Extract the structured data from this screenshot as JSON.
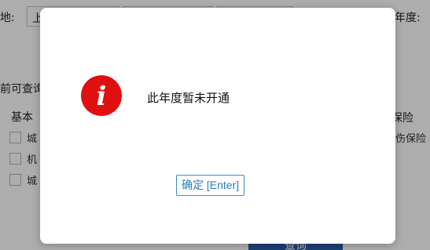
{
  "background": {
    "region_label": "地:",
    "region_select_value": "上",
    "year_label": "年度:",
    "query_hint": "前可查询",
    "basic_section_label": "基本",
    "insurance_section_label": "保险",
    "left_items": [
      "城",
      "机",
      "城"
    ],
    "right_item": "伤保险",
    "query_button": "查询"
  },
  "dialog": {
    "message": "此年度暂未开通",
    "icon": "info-icon",
    "icon_color": "#e01010",
    "confirm_label": "确定 [Enter]"
  }
}
